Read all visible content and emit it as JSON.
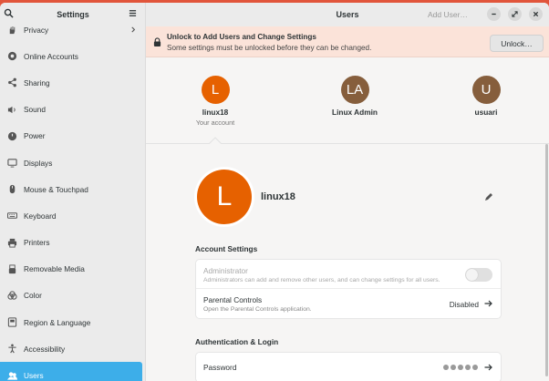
{
  "sidebar": {
    "title": "Settings",
    "items": [
      {
        "label": "Privacy",
        "icon": "hand-icon"
      },
      {
        "label": "Online Accounts",
        "icon": "online-accounts-icon"
      },
      {
        "label": "Sharing",
        "icon": "share-icon"
      },
      {
        "label": "Sound",
        "icon": "speaker-icon"
      },
      {
        "label": "Power",
        "icon": "power-icon"
      },
      {
        "label": "Displays",
        "icon": "display-icon"
      },
      {
        "label": "Mouse & Touchpad",
        "icon": "mouse-icon"
      },
      {
        "label": "Keyboard",
        "icon": "keyboard-icon"
      },
      {
        "label": "Printers",
        "icon": "printer-icon"
      },
      {
        "label": "Removable Media",
        "icon": "usb-drive-icon"
      },
      {
        "label": "Color",
        "icon": "color-palette-icon"
      },
      {
        "label": "Region & Language",
        "icon": "region-flag-icon"
      },
      {
        "label": "Accessibility",
        "icon": "accessibility-icon"
      },
      {
        "label": "Users",
        "icon": "users-icon",
        "active": true
      }
    ]
  },
  "header": {
    "title": "Users",
    "add_user_label": "Add User…"
  },
  "unlock_bar": {
    "title": "Unlock to Add Users and Change Settings",
    "subtitle": "Some settings must be unlocked before they can be changed.",
    "button_label": "Unlock…"
  },
  "users": [
    {
      "initials": "L",
      "name": "linux18",
      "subtitle": "Your account",
      "color": "#e66100"
    },
    {
      "initials": "LA",
      "name": "Linux Admin",
      "subtitle": "",
      "color": "#865e3c"
    },
    {
      "initials": "U",
      "name": "usuari",
      "subtitle": "",
      "color": "#865e3c"
    }
  ],
  "detail": {
    "avatar_initial": "L",
    "avatar_color": "#e66100",
    "username": "linux18",
    "account_settings": {
      "title": "Account Settings",
      "administrator_label": "Administrator",
      "administrator_desc": "Administrators can add and remove other users, and can change settings for all users.",
      "parental_label": "Parental Controls",
      "parental_desc": "Open the Parental Controls application.",
      "parental_value": "Disabled"
    },
    "auth": {
      "title": "Authentication & Login",
      "password_label": "Password"
    }
  },
  "colors": {
    "accent": "#3daee9",
    "topbar": "#e1553b",
    "unlock_bg": "#fbe3d9"
  }
}
